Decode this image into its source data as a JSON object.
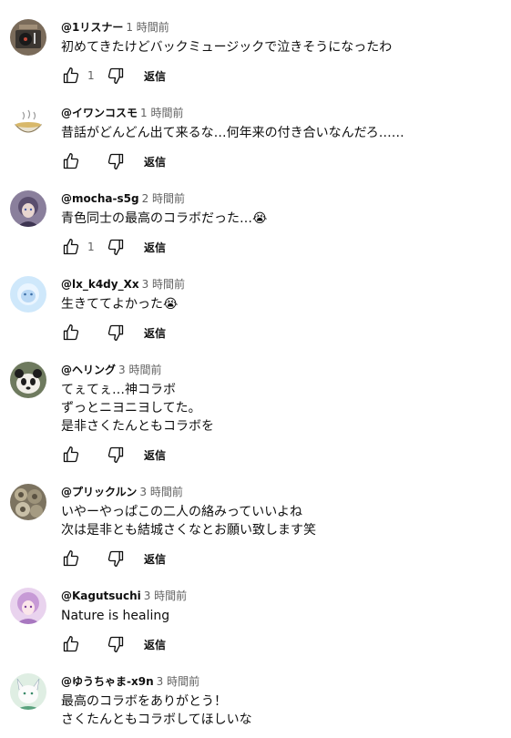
{
  "comments": [
    {
      "author": "@1リスナー",
      "time": "1 時間前",
      "text": "初めてきたけどバックミュージックで泣きそうになったわ",
      "likes": "1",
      "reply": "返信",
      "avatar": "record-player-avatar"
    },
    {
      "author": "@イワンコスモ",
      "time": "1 時間前",
      "text": "昔話がどんどん出て来るな…何年来の付き合いなんだろ……",
      "likes": "",
      "reply": "返信",
      "avatar": "bowl-illustration-avatar"
    },
    {
      "author": "@mocha-s5g",
      "time": "2 時間前",
      "text": "青色同士の最高のコラボだった…😭",
      "likes": "1",
      "reply": "返信",
      "avatar": "anime-character-avatar"
    },
    {
      "author": "@lx_k4dy_Xx",
      "time": "3 時間前",
      "text": "生きててよかった😭",
      "likes": "",
      "reply": "返信",
      "avatar": "blue-character-avatar"
    },
    {
      "author": "@ヘリング",
      "time": "3 時間前",
      "text": "てぇてぇ…神コラボ\nずっとニヨニヨしてた。\n是非さくたんともコラボを",
      "likes": "",
      "reply": "返信",
      "avatar": "panda-avatar"
    },
    {
      "author": "@プリックルン",
      "time": "3 時間前",
      "text": "いやーやっぱこの二人の絡みっていいよね\n次は是非とも結城さくなとお願い致します笑",
      "likes": "",
      "reply": "返信",
      "avatar": "shells-photo-avatar"
    },
    {
      "author": "@Kagutsuchi",
      "time": "3 時間前",
      "text": "Nature is healing",
      "likes": "",
      "reply": "返信",
      "avatar": "pink-anime-avatar"
    },
    {
      "author": "@ゆうちゃま-x9n",
      "time": "3 時間前",
      "text": "最高のコラボをありがとう！\nさくたんともコラボしてほしいな",
      "likes": "",
      "reply": "返信",
      "avatar": "white-fox-avatar"
    }
  ]
}
